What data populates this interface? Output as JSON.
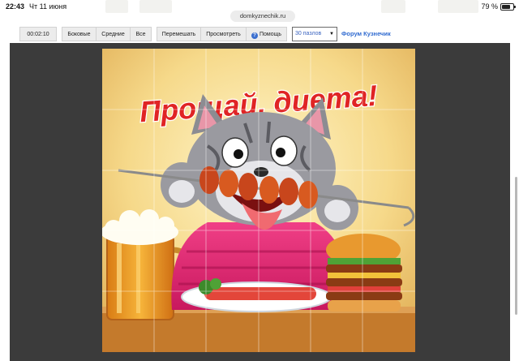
{
  "statusbar": {
    "time": "22:43",
    "date": "Чт 11 июня",
    "battery_text": "79 %",
    "battery_level": 0.79
  },
  "address": "domkyznechik.ru",
  "toolbar": {
    "timer": "00:02:10",
    "btn_side": "Боковые",
    "btn_middle": "Средние",
    "btn_all": "Все",
    "btn_shuffle": "Перемешать",
    "btn_preview": "Просмотреть",
    "btn_help": "Помощь",
    "select_value": "30 пазлов",
    "forum_link": "Форум Кузнечик"
  },
  "puzzle": {
    "caption": "Прощай, диета!"
  },
  "colors": {
    "accent": "#2f6ad0",
    "board_bg": "#3b3b3b",
    "caption_red": "#e02424"
  },
  "icons": {
    "help": "question-circle-icon",
    "wifi": "wifi-icon",
    "battery": "battery-icon",
    "dropdown": "chevron-down-icon"
  }
}
